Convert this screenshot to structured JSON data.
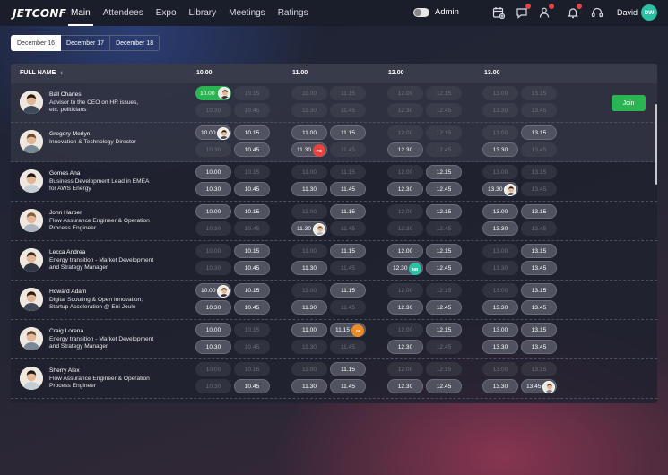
{
  "app": {
    "logo": "JETCONF",
    "nav": [
      "Main",
      "Attendees",
      "Expo",
      "Library",
      "Meetings",
      "Ratings"
    ],
    "active_nav": 0,
    "admin_label": "Admin",
    "user_name": "David",
    "user_initials": "DW",
    "icons": [
      "calendar-plus-icon",
      "chat-bubble-icon",
      "add-person-icon",
      "bell-icon",
      "headset-icon"
    ],
    "badge_icons": [
      "chat-bubble-icon",
      "add-person-icon",
      "bell-icon"
    ],
    "colors": {
      "accent_green": "#2bb552",
      "avatar_teal": "#2bbfa3",
      "badge_red": "#e8433e",
      "badge_orange": "#f08a24"
    }
  },
  "days": [
    "December 16",
    "December 17",
    "December 18"
  ],
  "active_day": 0,
  "table": {
    "col_name": "FULL NAME",
    "sort_icon": "sort-icon",
    "hours": [
      "10.00",
      "11.00",
      "12.00",
      "13.00"
    ],
    "join_label": "Join",
    "rows": [
      {
        "name": "Ball Charles",
        "role": [
          "Advisor to the CEO on HR issues,",
          "etc. politicians"
        ],
        "join": true,
        "slots": [
          {
            "t": "10.00",
            "s": "green",
            "a": "photo"
          },
          {
            "t": "10.15",
            "s": "faded"
          },
          {
            "t": "10.30",
            "s": "faded"
          },
          {
            "t": "10.45",
            "s": "faded"
          },
          {
            "t": "11.00",
            "s": "faded"
          },
          {
            "t": "11.15",
            "s": "faded"
          },
          {
            "t": "11.30",
            "s": "faded"
          },
          {
            "t": "11.45",
            "s": "faded"
          },
          {
            "t": "12.00",
            "s": "faded"
          },
          {
            "t": "12.15",
            "s": "faded"
          },
          {
            "t": "12.30",
            "s": "faded"
          },
          {
            "t": "12.45",
            "s": "faded"
          },
          {
            "t": "13.00",
            "s": "faded"
          },
          {
            "t": "13.15",
            "s": "faded"
          },
          {
            "t": "13.30",
            "s": "faded"
          },
          {
            "t": "13.45",
            "s": "faded"
          }
        ]
      },
      {
        "name": "Gregory Merlyn",
        "role": [
          "Innovation & Technology Director"
        ],
        "slots": [
          {
            "t": "10.00",
            "s": "booked",
            "a": "photo"
          },
          {
            "t": "10.15",
            "s": "on"
          },
          {
            "t": "10.30",
            "s": "faded"
          },
          {
            "t": "10.45",
            "s": "on"
          },
          {
            "t": "11.00",
            "s": "on"
          },
          {
            "t": "11.15",
            "s": "on"
          },
          {
            "t": "11.30",
            "s": "booked",
            "i": "FS",
            "c": "#e8433e"
          },
          {
            "t": "11.45",
            "s": "faded"
          },
          {
            "t": "12.00",
            "s": "faded"
          },
          {
            "t": "12.15",
            "s": "faded"
          },
          {
            "t": "12.30",
            "s": "on"
          },
          {
            "t": "12.45",
            "s": "faded"
          },
          {
            "t": "13.00",
            "s": "faded"
          },
          {
            "t": "13.15",
            "s": "on"
          },
          {
            "t": "13.30",
            "s": "on"
          },
          {
            "t": "13.45",
            "s": "faded"
          }
        ]
      },
      {
        "name": "Gomes Ana",
        "role": [
          "Business Development Lead in EMEA",
          "for AWS Energy"
        ],
        "slots": [
          {
            "t": "10.00",
            "s": "on"
          },
          {
            "t": "10.15",
            "s": "faded"
          },
          {
            "t": "10.30",
            "s": "on"
          },
          {
            "t": "10.45",
            "s": "on"
          },
          {
            "t": "11.00",
            "s": "faded"
          },
          {
            "t": "11.15",
            "s": "faded"
          },
          {
            "t": "11.30",
            "s": "on"
          },
          {
            "t": "11.45",
            "s": "on"
          },
          {
            "t": "12.00",
            "s": "faded"
          },
          {
            "t": "12.15",
            "s": "on"
          },
          {
            "t": "12.30",
            "s": "on"
          },
          {
            "t": "12.45",
            "s": "on"
          },
          {
            "t": "13.00",
            "s": "faded"
          },
          {
            "t": "13.15",
            "s": "faded"
          },
          {
            "t": "13.30",
            "s": "booked",
            "a": "photo"
          },
          {
            "t": "13.45",
            "s": "faded"
          }
        ]
      },
      {
        "name": "John Harper",
        "role": [
          "Flow Assurance Engineer & Operation",
          "Process Engineer"
        ],
        "slots": [
          {
            "t": "10.00",
            "s": "on"
          },
          {
            "t": "10.15",
            "s": "on"
          },
          {
            "t": "10.30",
            "s": "faded"
          },
          {
            "t": "10.45",
            "s": "faded"
          },
          {
            "t": "11.00",
            "s": "faded"
          },
          {
            "t": "11.15",
            "s": "on"
          },
          {
            "t": "11.30",
            "s": "booked",
            "a": "photo"
          },
          {
            "t": "11.45",
            "s": "faded"
          },
          {
            "t": "12.00",
            "s": "faded"
          },
          {
            "t": "12.15",
            "s": "on"
          },
          {
            "t": "12.30",
            "s": "faded"
          },
          {
            "t": "12.45",
            "s": "faded"
          },
          {
            "t": "13.00",
            "s": "on"
          },
          {
            "t": "13.15",
            "s": "on"
          },
          {
            "t": "13.30",
            "s": "on"
          },
          {
            "t": "13.45",
            "s": "faded"
          }
        ]
      },
      {
        "name": "Lecca Andrea",
        "role": [
          "Energy transition - Market Development",
          "and Strategy Manager"
        ],
        "slots": [
          {
            "t": "10.00",
            "s": "faded"
          },
          {
            "t": "10.15",
            "s": "on"
          },
          {
            "t": "10.30",
            "s": "faded"
          },
          {
            "t": "10.45",
            "s": "on"
          },
          {
            "t": "11.00",
            "s": "faded"
          },
          {
            "t": "11.15",
            "s": "on"
          },
          {
            "t": "11.30",
            "s": "on"
          },
          {
            "t": "11.45",
            "s": "faded"
          },
          {
            "t": "12.00",
            "s": "on"
          },
          {
            "t": "12.15",
            "s": "on"
          },
          {
            "t": "12.30",
            "s": "booked",
            "i": "NB",
            "c": "#2bbfa3"
          },
          {
            "t": "12.45",
            "s": "on"
          },
          {
            "t": "13.00",
            "s": "faded"
          },
          {
            "t": "13.15",
            "s": "on"
          },
          {
            "t": "13.30",
            "s": "faded"
          },
          {
            "t": "13.45",
            "s": "on"
          }
        ]
      },
      {
        "name": "Howard Adam",
        "role": [
          "Digital Scouting & Open Innovation;",
          "Startup Acceleration @ Eni Joule"
        ],
        "slots": [
          {
            "t": "10.00",
            "s": "booked",
            "a": "photo"
          },
          {
            "t": "10.15",
            "s": "on"
          },
          {
            "t": "10.30",
            "s": "on"
          },
          {
            "t": "10.45",
            "s": "on"
          },
          {
            "t": "11.00",
            "s": "faded"
          },
          {
            "t": "11.15",
            "s": "on"
          },
          {
            "t": "11.30",
            "s": "on"
          },
          {
            "t": "11.45",
            "s": "faded"
          },
          {
            "t": "12.00",
            "s": "faded"
          },
          {
            "t": "12.15",
            "s": "faded"
          },
          {
            "t": "12.30",
            "s": "on"
          },
          {
            "t": "12.45",
            "s": "on"
          },
          {
            "t": "13.00",
            "s": "faded"
          },
          {
            "t": "13.15",
            "s": "on"
          },
          {
            "t": "13.30",
            "s": "on"
          },
          {
            "t": "13.45",
            "s": "on"
          }
        ]
      },
      {
        "name": "Craig Lorena",
        "role": [
          "Energy transition - Market Development",
          "and Strategy Manager"
        ],
        "slots": [
          {
            "t": "10.00",
            "s": "on"
          },
          {
            "t": "10.15",
            "s": "faded"
          },
          {
            "t": "10.30",
            "s": "on"
          },
          {
            "t": "10.45",
            "s": "faded"
          },
          {
            "t": "11.00",
            "s": "on"
          },
          {
            "t": "11.15",
            "s": "booked",
            "i": "JA",
            "c": "#f08a24"
          },
          {
            "t": "11.30",
            "s": "faded"
          },
          {
            "t": "11.45",
            "s": "faded"
          },
          {
            "t": "12.00",
            "s": "faded"
          },
          {
            "t": "12.15",
            "s": "on"
          },
          {
            "t": "12.30",
            "s": "on"
          },
          {
            "t": "12.45",
            "s": "faded"
          },
          {
            "t": "13.00",
            "s": "on"
          },
          {
            "t": "13.15",
            "s": "on"
          },
          {
            "t": "13.30",
            "s": "on"
          },
          {
            "t": "13.45",
            "s": "on"
          }
        ]
      },
      {
        "name": "Sherry Alex",
        "role": [
          "Flow Assurance Engineer & Operation",
          "Process Engineer"
        ],
        "slots": [
          {
            "t": "10.00",
            "s": "faded"
          },
          {
            "t": "10.15",
            "s": "faded"
          },
          {
            "t": "10.30",
            "s": "faded"
          },
          {
            "t": "10.45",
            "s": "on"
          },
          {
            "t": "11.00",
            "s": "faded"
          },
          {
            "t": "11.15",
            "s": "on"
          },
          {
            "t": "11.30",
            "s": "on"
          },
          {
            "t": "11.45",
            "s": "on"
          },
          {
            "t": "12.00",
            "s": "faded"
          },
          {
            "t": "12.15",
            "s": "faded"
          },
          {
            "t": "12.30",
            "s": "on"
          },
          {
            "t": "12.45",
            "s": "on"
          },
          {
            "t": "13.00",
            "s": "faded"
          },
          {
            "t": "13.15",
            "s": "faded"
          },
          {
            "t": "13.30",
            "s": "on"
          },
          {
            "t": "13.45",
            "s": "booked",
            "a": "photo"
          }
        ]
      }
    ]
  }
}
